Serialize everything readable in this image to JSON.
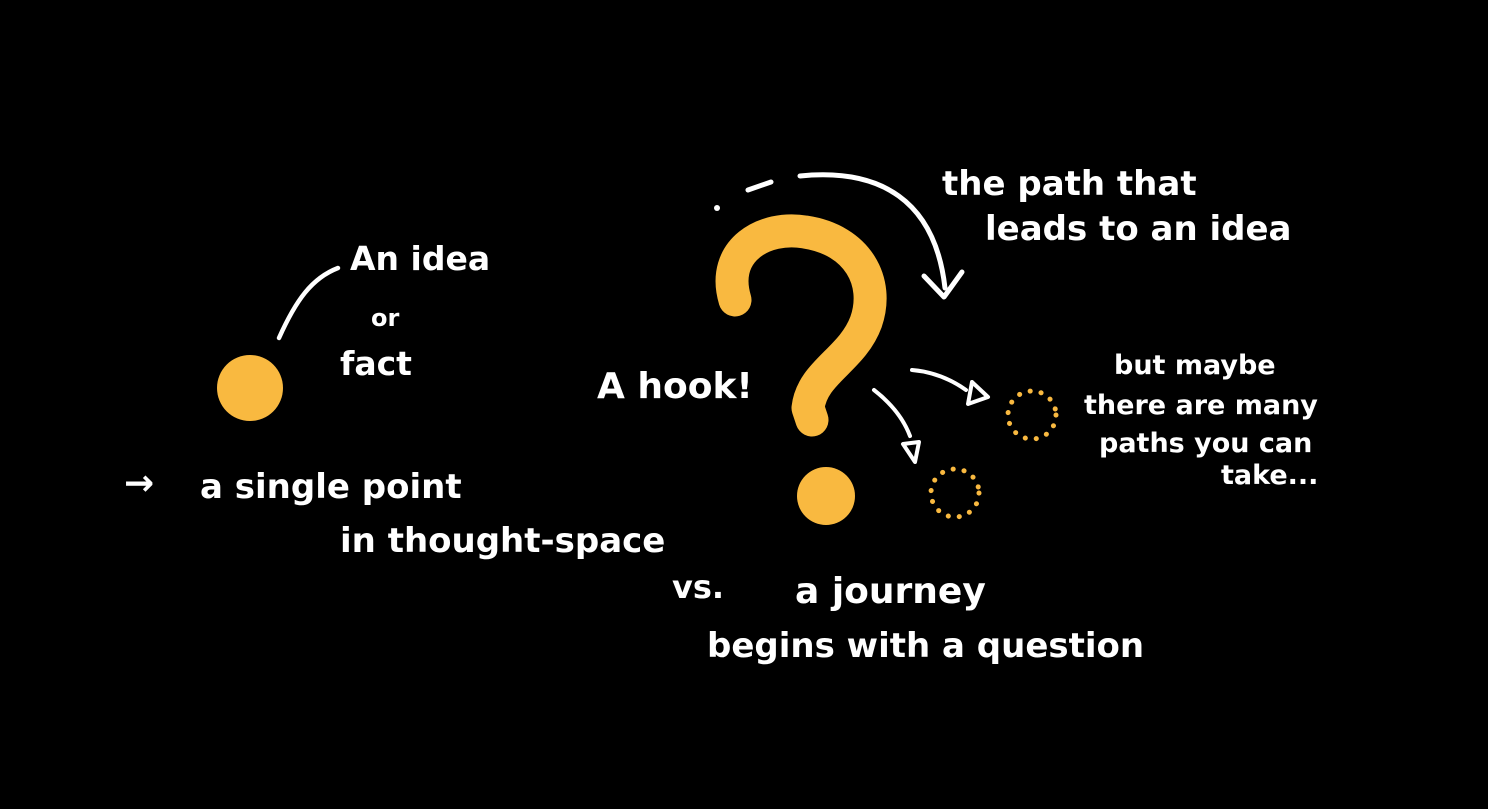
{
  "colors": {
    "background": "#000000",
    "ink": "#ffffff",
    "accent": "#f9b940"
  },
  "left": {
    "label_line1": "An idea",
    "label_line2": "or",
    "label_line3": "fact",
    "arrow_glyph": "→",
    "caption_line1": "a single point",
    "caption_line2": "in thought-space"
  },
  "center": {
    "vs_text": "vs.",
    "hook_label": "A hook!",
    "path_label_line1": "the path that",
    "path_label_line2": "leads to an idea",
    "caption_line1": "a journey",
    "caption_line2": "begins with a question"
  },
  "right": {
    "note_line1": "but maybe",
    "note_line2": "there are many",
    "note_line3": "paths you can",
    "note_line4": "take..."
  }
}
